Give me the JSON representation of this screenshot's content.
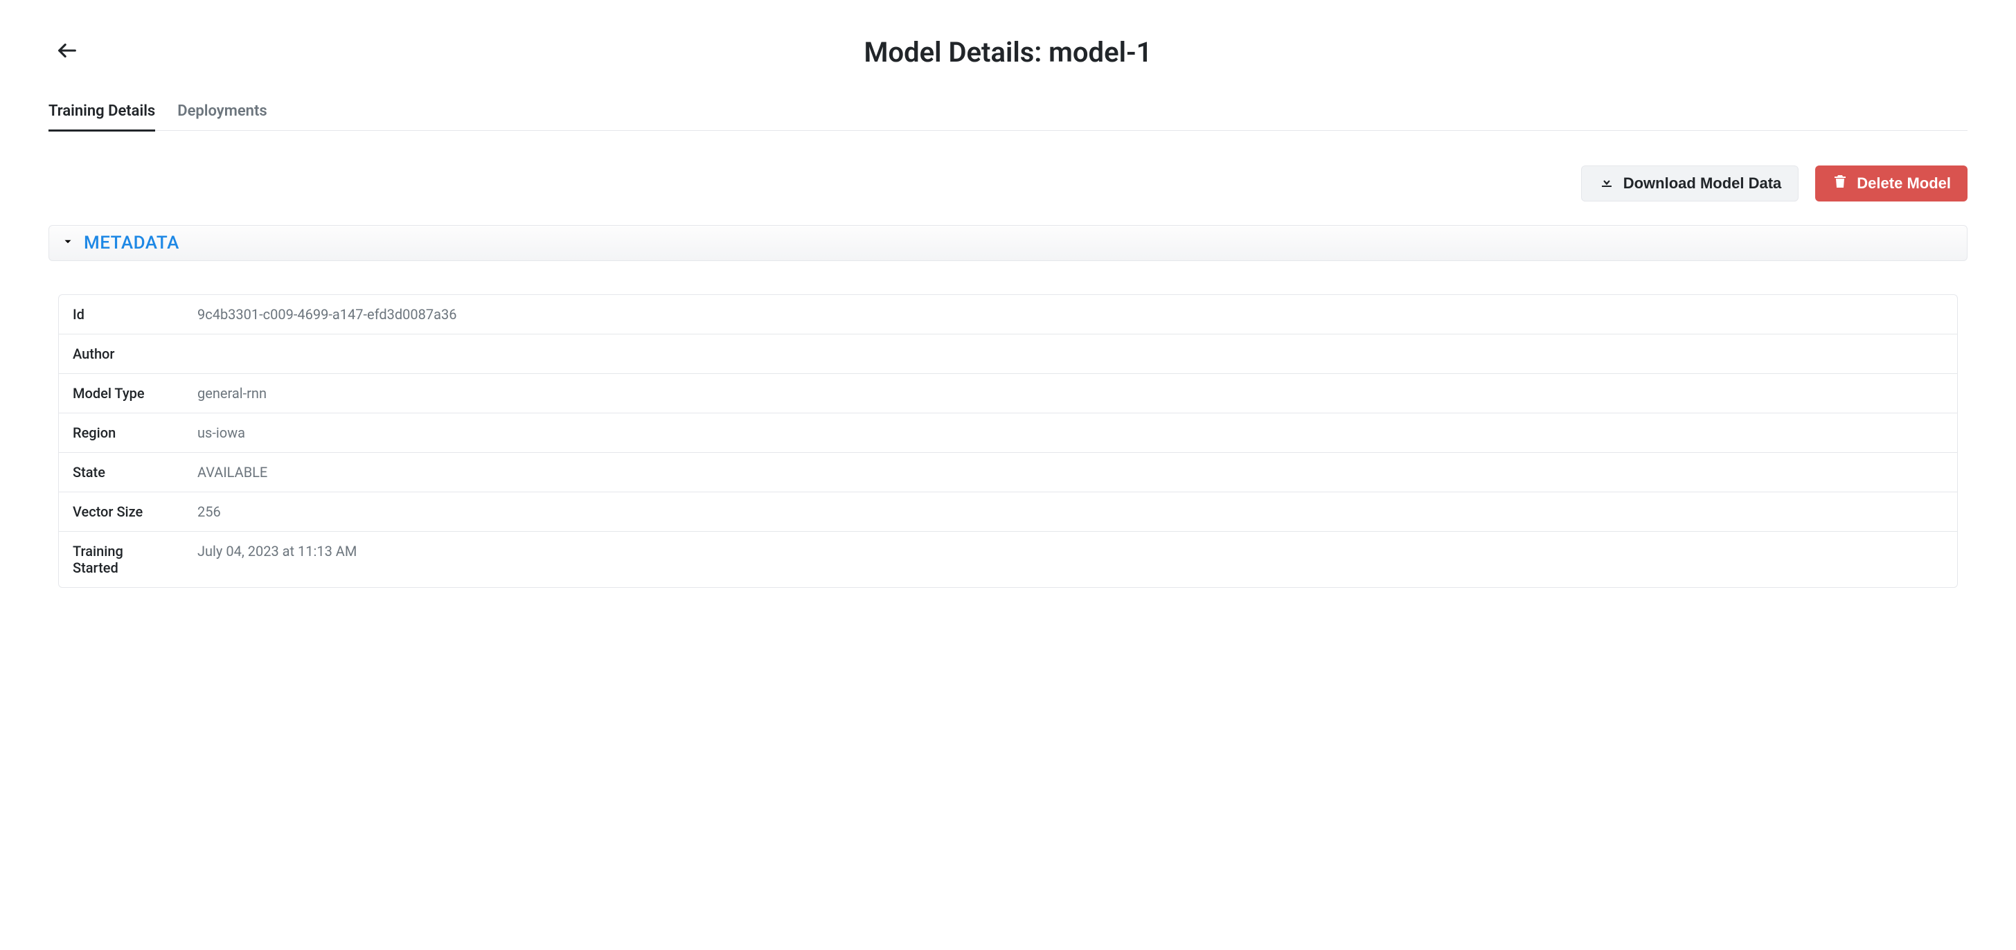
{
  "header": {
    "title_prefix": "Model Details: ",
    "model_name": "model-1"
  },
  "tabs": [
    {
      "label": "Training Details",
      "active": true
    },
    {
      "label": "Deployments",
      "active": false
    }
  ],
  "actions": {
    "download_label": "Download Model Data",
    "delete_label": "Delete Model"
  },
  "section": {
    "metadata_title": "METADATA"
  },
  "metadata": {
    "rows": [
      {
        "label": "Id",
        "value": "9c4b3301-c009-4699-a147-efd3d0087a36"
      },
      {
        "label": "Author",
        "value": ""
      },
      {
        "label": "Model Type",
        "value": "general-rnn"
      },
      {
        "label": "Region",
        "value": "us-iowa"
      },
      {
        "label": "State",
        "value": "AVAILABLE"
      },
      {
        "label": "Vector Size",
        "value": "256"
      },
      {
        "label": "Training Started",
        "value": "July 04, 2023 at 11:13 AM"
      }
    ]
  }
}
